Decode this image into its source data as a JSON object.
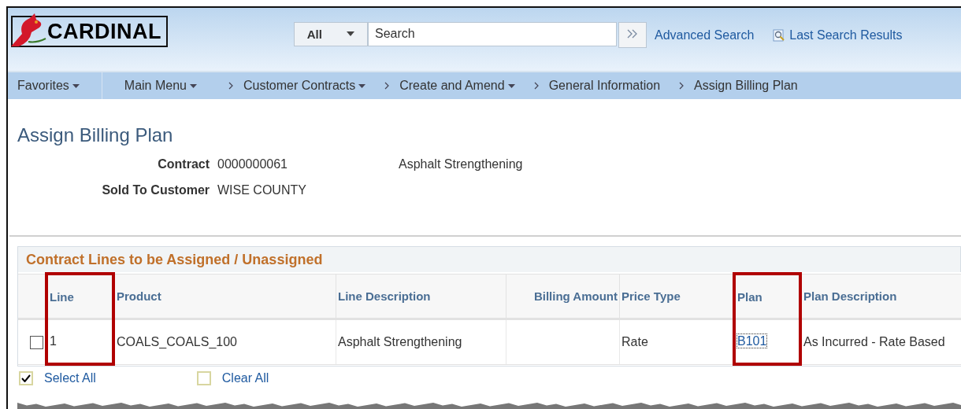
{
  "header": {
    "logo": "CARDINAL",
    "search_scope": "All",
    "search": {
      "placeholder": "Search"
    },
    "links": [
      {
        "label": "Advanced Search",
        "kind": "plain"
      },
      {
        "label": "Last Search Results",
        "kind": "icon"
      }
    ]
  },
  "nav": [
    {
      "label": "Favorites",
      "dropdown": true,
      "kind": "menu"
    },
    {
      "label": "Main Menu",
      "dropdown": true,
      "kind": "menu"
    },
    {
      "label": "Customer Contracts",
      "dropdown": true,
      "kind": "crumb"
    },
    {
      "label": "Create and Amend",
      "dropdown": true,
      "kind": "crumb"
    },
    {
      "label": "General Information",
      "dropdown": false,
      "kind": "crumb"
    },
    {
      "label": "Assign Billing Plan",
      "dropdown": false,
      "kind": "crumb"
    }
  ],
  "page_title": "Assign Billing Plan",
  "fields": [
    {
      "label": "Contract",
      "value": "0000000061",
      "extra": "Asphalt Strengthening"
    },
    {
      "label": "Sold To Customer",
      "value": "WISE COUNTY"
    }
  ],
  "grid": {
    "title": "Contract Lines to be Assigned / Unassigned",
    "columns": [
      {
        "label": "Line",
        "highlighted": true
      },
      {
        "label": "Product",
        "highlighted": false
      },
      {
        "label": "Line Description",
        "highlighted": false
      },
      {
        "label": "Billing Amount",
        "highlighted": false
      },
      {
        "label": "Price Type",
        "highlighted": false
      },
      {
        "label": "Plan",
        "highlighted": true
      },
      {
        "label": "Plan Description",
        "highlighted": false
      }
    ],
    "rows": [
      {
        "checked": false,
        "cells": [
          "1",
          "COALS_COALS_100",
          "Asphalt Strengthening",
          "",
          "Rate",
          "B101",
          "As Incurred - Rate Based"
        ]
      }
    ]
  },
  "actions": [
    {
      "label": "Select All",
      "checked": true
    },
    {
      "label": "Clear All",
      "checked": false
    }
  ]
}
